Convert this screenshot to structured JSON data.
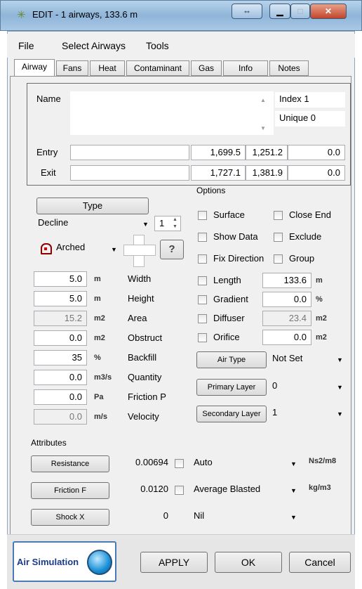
{
  "window": {
    "title": "EDIT -  1 airways, 133.6 m",
    "icon": "fan-icon",
    "controls": {
      "restore": "⇔",
      "minimize": "▁",
      "maximize": "□",
      "close": "✕"
    }
  },
  "menu": [
    "File",
    "Select Airways",
    "Tools"
  ],
  "tabs": [
    "Airway",
    "Fans",
    "Heat",
    "Contaminant",
    "Gas",
    "Info",
    "Notes"
  ],
  "name_section": {
    "name_label": "Name",
    "name_value": "",
    "index": "Index 1",
    "unique": "Unique 0",
    "entry_label": "Entry",
    "entry": [
      "",
      "1,699.5",
      "1,251.2",
      "0.0"
    ],
    "exit_label": "Exit",
    "exit": [
      "",
      "1,727.1",
      "1,381.9",
      "0.0"
    ]
  },
  "left": {
    "type_button": "Type",
    "type_value": "Decline",
    "spinner_value": "1",
    "shape_value": "Arched",
    "help_button": "?",
    "params": [
      {
        "value": "5.0",
        "unit": "m",
        "label": "Width",
        "disabled": false
      },
      {
        "value": "5.0",
        "unit": "m",
        "label": "Height",
        "disabled": false
      },
      {
        "value": "15.2",
        "unit": "m2",
        "label": "Area",
        "disabled": true
      },
      {
        "value": "0.0",
        "unit": "m2",
        "label": "Obstruct",
        "disabled": false
      },
      {
        "value": "35",
        "unit": "%",
        "label": "Backfill",
        "disabled": false
      },
      {
        "value": "0.0",
        "unit": "m3/s",
        "label": "Quantity",
        "disabled": false
      },
      {
        "value": "0.0",
        "unit": "Pa",
        "label": "Friction P",
        "disabled": false
      },
      {
        "value": "0.0",
        "unit": "m/s",
        "label": "Velocity",
        "disabled": true
      }
    ]
  },
  "options": {
    "title": "Options",
    "checks": [
      {
        "label": "Surface"
      },
      {
        "label": "Close End"
      },
      {
        "label": "Show Data"
      },
      {
        "label": "Exclude"
      },
      {
        "label": "Fix Direction"
      },
      {
        "label": "Group"
      }
    ],
    "rows": [
      {
        "label": "Length",
        "value": "133.6",
        "unit": "m",
        "disabled": false
      },
      {
        "label": "Gradient",
        "value": "0.0",
        "unit": "%",
        "disabled": false
      },
      {
        "label": "Diffuser",
        "value": "23.4",
        "unit": "m2",
        "disabled": true
      },
      {
        "label": "Orifice",
        "value": "0.0",
        "unit": "m2",
        "disabled": false
      }
    ],
    "air_type_button": "Air Type",
    "air_type_value": "Not Set",
    "primary_button": "Primary Layer",
    "primary_value": "0",
    "secondary_button": "Secondary Layer",
    "secondary_value": "1"
  },
  "attributes": {
    "title": "Attributes",
    "rows": [
      {
        "button": "Resistance",
        "value": "0.00694",
        "has_check": true,
        "dropdown": "Auto",
        "unit": "Ns2/m8"
      },
      {
        "button": "Friction F",
        "value": "0.0120",
        "has_check": true,
        "dropdown": "Average Blasted",
        "unit": "kg/m3"
      },
      {
        "button": "Shock X",
        "value": "0",
        "has_check": false,
        "dropdown": "Nil",
        "unit": ""
      }
    ]
  },
  "footer": {
    "air_sim": "Air Simulation",
    "apply": "APPLY",
    "ok": "OK",
    "cancel": "Cancel"
  }
}
